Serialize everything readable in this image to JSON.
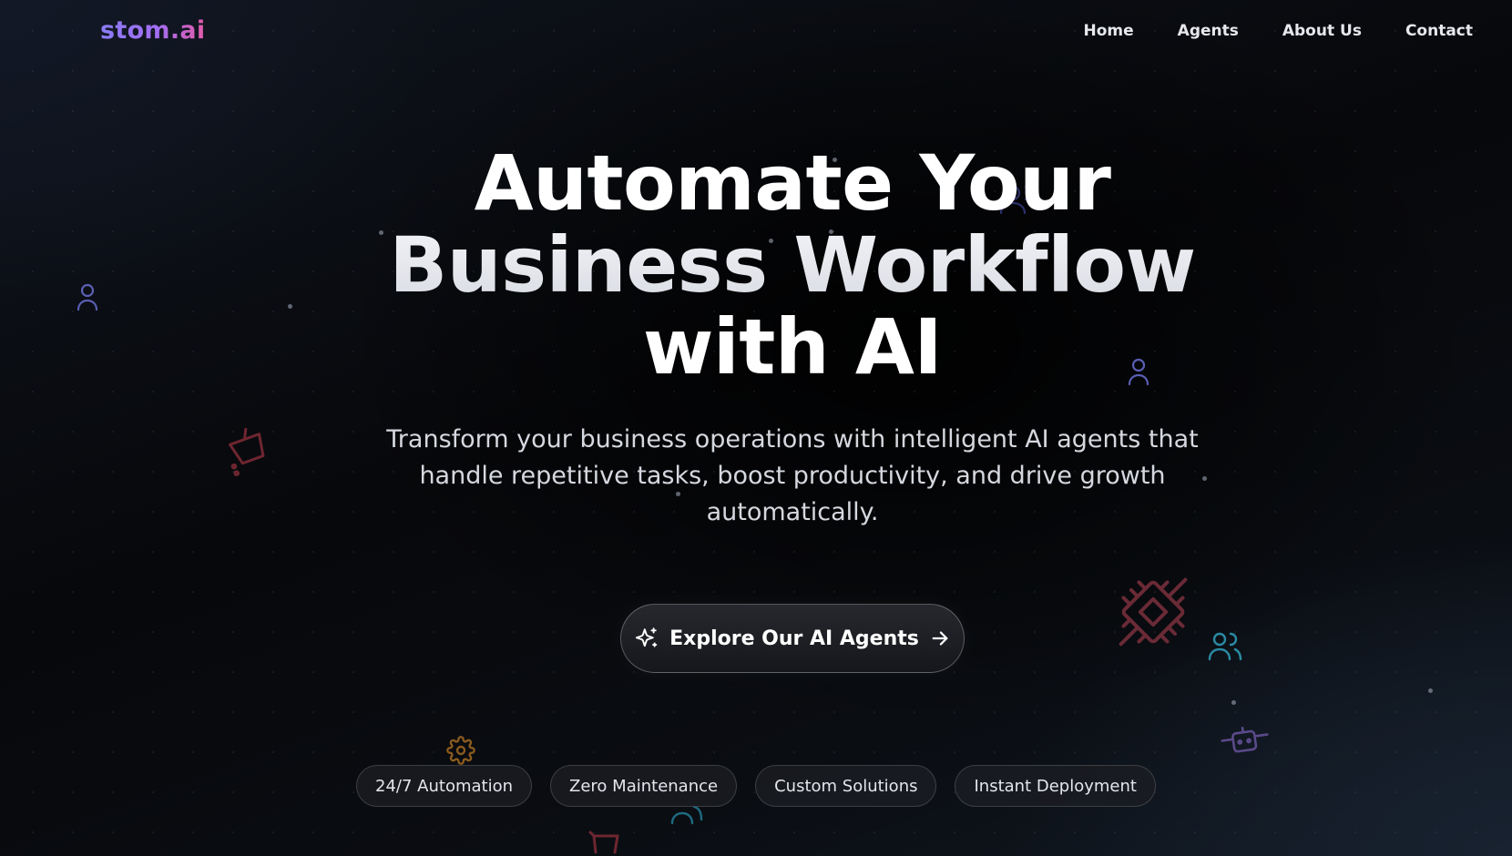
{
  "header": {
    "logo": "stom.ai",
    "nav": [
      "Home",
      "Agents",
      "About Us",
      "Contact"
    ]
  },
  "hero": {
    "title_lines": [
      "Automate Your",
      "Business Workflow",
      "with AI"
    ],
    "subtitle": "Transform your business operations with intelligent AI agents that handle repetitive tasks, boost productivity, and drive growth automatically.",
    "cta_label": "Explore Our AI Agents",
    "features": [
      "24/7 Automation",
      "Zero Maintenance",
      "Custom Solutions",
      "Instant Deployment"
    ]
  },
  "icons": {
    "cta_leading": "sparkles-icon",
    "cta_trailing": "arrow-right-icon",
    "background_decorations": [
      "user-icon",
      "user-icon",
      "users-icon",
      "users-icon",
      "cpu-chip-icon",
      "shopping-cart-icon",
      "shopping-cart-icon",
      "gear-icon",
      "bot-icon"
    ]
  },
  "colors": {
    "background": "#07080b",
    "logo_gradient_start": "#8b7cf6",
    "logo_gradient_end": "#e55aa8",
    "text_primary": "#ffffff",
    "text_secondary": "#d5d8df"
  }
}
